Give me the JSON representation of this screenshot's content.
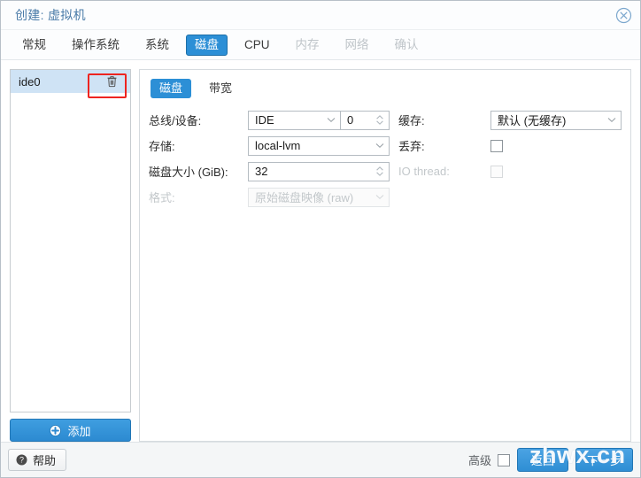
{
  "window": {
    "title": "创建: 虚拟机",
    "close_icon": "close-circle-icon"
  },
  "tabs": [
    {
      "label": "常规",
      "state": "normal"
    },
    {
      "label": "操作系统",
      "state": "normal"
    },
    {
      "label": "系统",
      "state": "normal"
    },
    {
      "label": "磁盘",
      "state": "active"
    },
    {
      "label": "CPU",
      "state": "normal"
    },
    {
      "label": "内存",
      "state": "disabled"
    },
    {
      "label": "网络",
      "state": "disabled"
    },
    {
      "label": "确认",
      "state": "disabled"
    }
  ],
  "device_list": {
    "items": [
      {
        "label": "ide0",
        "selected": true,
        "delete_icon": "trash-icon"
      }
    ],
    "add_button": {
      "label": "添加",
      "icon": "plus-circle-icon"
    }
  },
  "subtabs": [
    {
      "label": "磁盘",
      "state": "active"
    },
    {
      "label": "带宽",
      "state": "normal"
    }
  ],
  "form": {
    "left": [
      {
        "label": "总线/设备:",
        "type": "combo-spinner",
        "value": "IDE",
        "spinner_value": "0",
        "disabled": false
      },
      {
        "label": "存储:",
        "type": "combo",
        "value": "local-lvm",
        "disabled": false
      },
      {
        "label": "磁盘大小 (GiB):",
        "type": "spinner",
        "value": "32",
        "disabled": false
      },
      {
        "label": "格式:",
        "type": "combo",
        "value": "原始磁盘映像 (raw)",
        "disabled": true
      }
    ],
    "right": [
      {
        "label": "缓存:",
        "type": "combo",
        "value": "默认 (无缓存)",
        "disabled": false
      },
      {
        "label": "丢弃:",
        "type": "checkbox",
        "checked": false,
        "disabled": false
      },
      {
        "label": "IO thread:",
        "type": "checkbox",
        "checked": false,
        "disabled": true
      }
    ]
  },
  "footer": {
    "help_label": "帮助",
    "help_icon": "question-circle-icon",
    "advanced_label": "高级",
    "advanced_checked": false,
    "back_label": "返回",
    "next_label": "下一步"
  },
  "overlay": {
    "watermark_text": "zhwx.cn",
    "highlight_color": "#ee2420"
  }
}
